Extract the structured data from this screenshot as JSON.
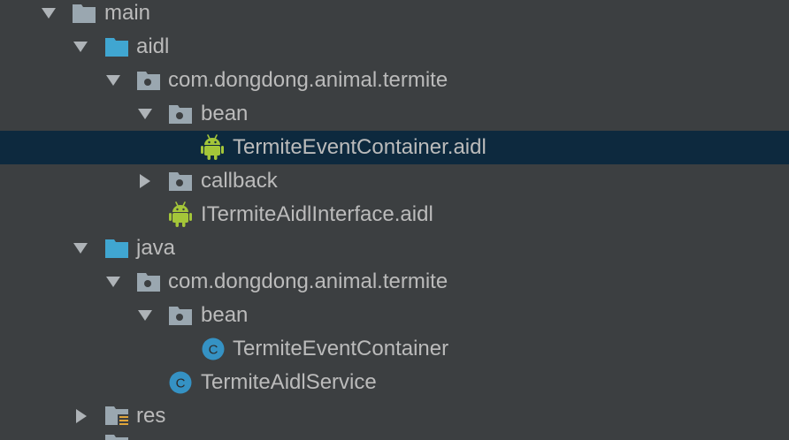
{
  "project_tree": {
    "items": [
      {
        "label": "main",
        "icon": "folder-icon",
        "expanded": true
      },
      {
        "label": "aidl",
        "icon": "source-folder-icon",
        "expanded": true
      },
      {
        "label": "com.dongdong.animal.termite",
        "icon": "package-icon",
        "expanded": true
      },
      {
        "label": "bean",
        "icon": "package-icon",
        "expanded": true
      },
      {
        "label": "TermiteEventContainer.aidl",
        "icon": "android-icon",
        "selected": true
      },
      {
        "label": "callback",
        "icon": "package-icon",
        "expanded": false
      },
      {
        "label": "ITermiteAidlInterface.aidl",
        "icon": "android-icon"
      },
      {
        "label": "java",
        "icon": "source-folder-icon",
        "expanded": true
      },
      {
        "label": "com.dongdong.animal.termite",
        "icon": "package-icon",
        "expanded": true
      },
      {
        "label": "bean",
        "icon": "package-icon",
        "expanded": true
      },
      {
        "label": "TermiteEventContainer",
        "icon": "class-icon"
      },
      {
        "label": "TermiteAidlService",
        "icon": "class-icon"
      },
      {
        "label": "res",
        "icon": "resource-folder-icon",
        "expanded": false
      }
    ]
  },
  "colors": {
    "background": "#3c3f41",
    "selection": "#0d293e",
    "text": "#bbbbbb",
    "folder": "#9aa7b0",
    "source_folder": "#40a6d1",
    "android": "#a4c639",
    "class": "#3592c4"
  }
}
